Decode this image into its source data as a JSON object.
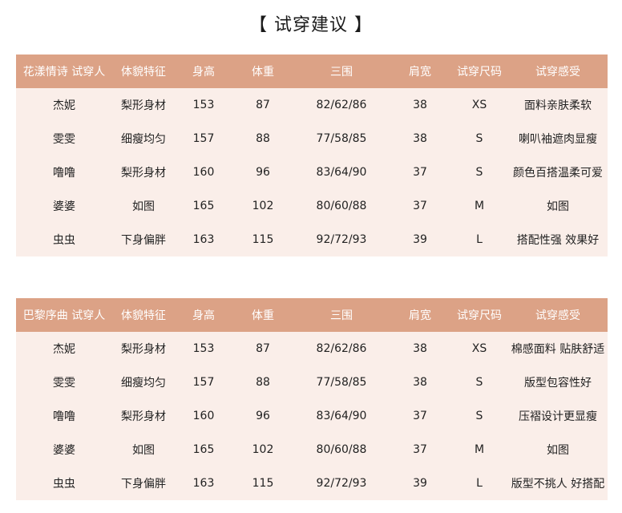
{
  "title": "【 试穿建议 】",
  "tables": [
    {
      "headers": [
        "花漾情诗 试穿人",
        "体貌特征",
        "身高",
        "体重",
        "三围",
        "肩宽",
        "试穿尺码",
        "试穿感受"
      ],
      "rows": [
        [
          "杰妮",
          "梨形身材",
          "153",
          "87",
          "82/62/86",
          "38",
          "XS",
          "面料亲肤柔软"
        ],
        [
          "雯雯",
          "细瘦均匀",
          "157",
          "88",
          "77/58/85",
          "38",
          "S",
          "喇叭袖遮肉显瘦"
        ],
        [
          "噜噜",
          "梨形身材",
          "160",
          "96",
          "83/64/90",
          "37",
          "S",
          "颜色百搭温柔可爱"
        ],
        [
          "婆婆",
          "如图",
          "165",
          "102",
          "80/60/88",
          "37",
          "M",
          "如图"
        ],
        [
          "虫虫",
          "下身偏胖",
          "163",
          "115",
          "92/72/93",
          "39",
          "L",
          "搭配性强 效果好"
        ]
      ]
    },
    {
      "headers": [
        "巴黎序曲 试穿人",
        "体貌特征",
        "身高",
        "体重",
        "三围",
        "肩宽",
        "试穿尺码",
        "试穿感受"
      ],
      "rows": [
        [
          "杰妮",
          "梨形身材",
          "153",
          "87",
          "82/62/86",
          "38",
          "XS",
          "棉感面料 贴肤舒适"
        ],
        [
          "雯雯",
          "细瘦均匀",
          "157",
          "88",
          "77/58/85",
          "38",
          "S",
          "版型包容性好"
        ],
        [
          "噜噜",
          "梨形身材",
          "160",
          "96",
          "83/64/90",
          "37",
          "S",
          "压褶设计更显瘦"
        ],
        [
          "婆婆",
          "如图",
          "165",
          "102",
          "80/60/88",
          "37",
          "M",
          "如图"
        ],
        [
          "虫虫",
          "下身偏胖",
          "163",
          "115",
          "92/72/93",
          "39",
          "L",
          "版型不挑人 好搭配"
        ]
      ]
    }
  ],
  "colors": {
    "header_bg": "#dca286",
    "row_bg": "#faeee9",
    "header_text": "#ffffff"
  }
}
